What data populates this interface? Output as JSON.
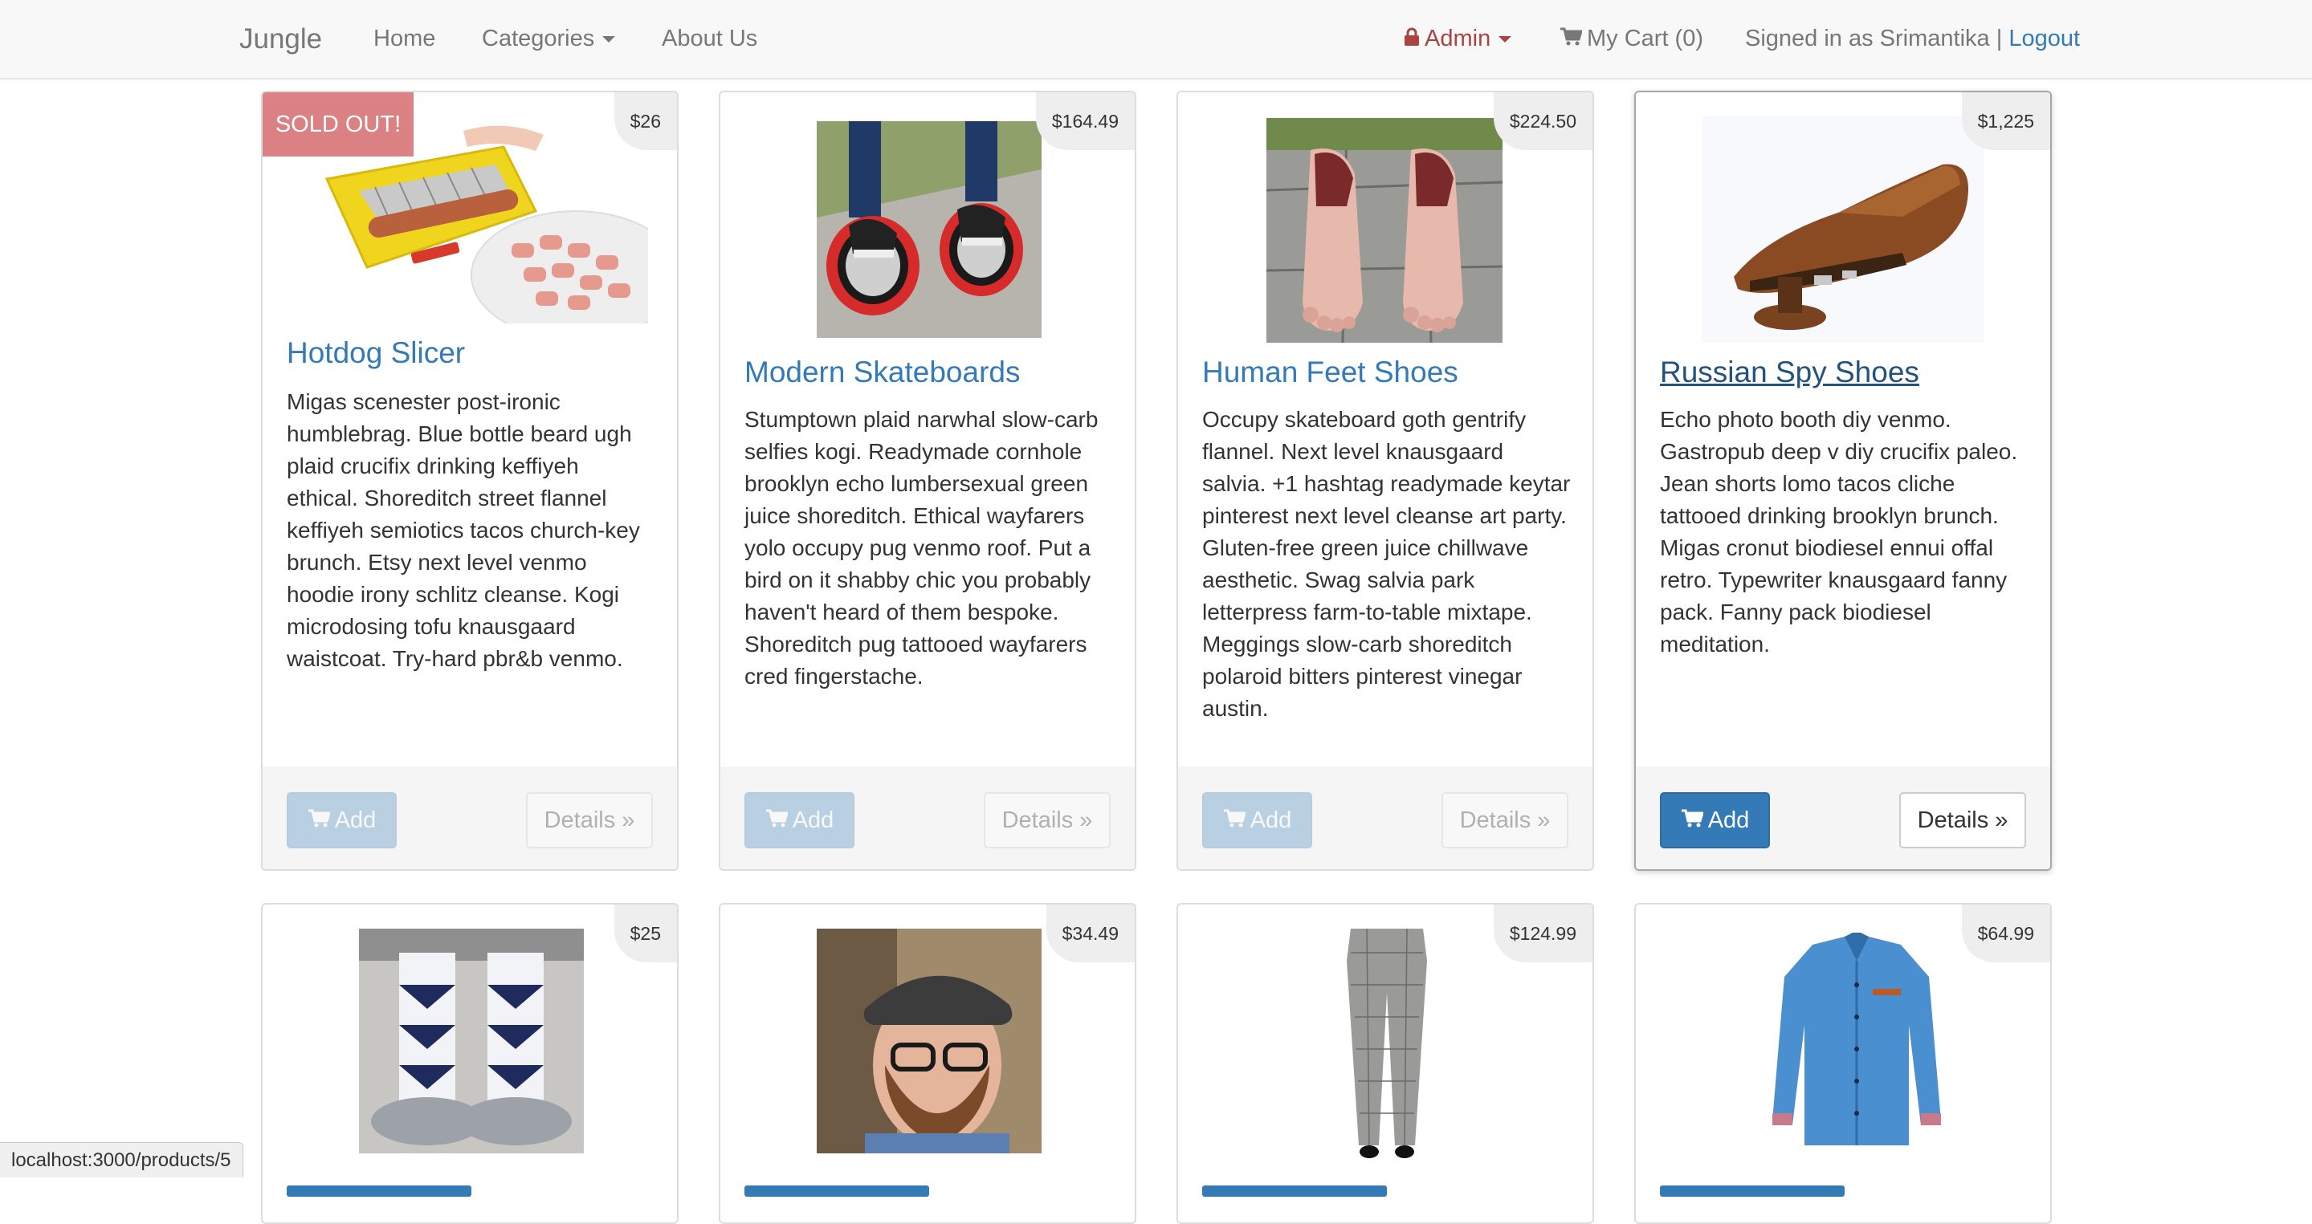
{
  "navbar": {
    "brand": "Jungle",
    "home": "Home",
    "categories": "Categories",
    "about": "About Us",
    "admin": "Admin",
    "cart": "My Cart (0)",
    "signed_in": "Signed in as Srimantika |",
    "logout": "Logout"
  },
  "products": [
    {
      "name": "Hotdog Slicer",
      "price": "$26",
      "sold_out": "SOLD OUT!",
      "description": "Migas scenester post-ironic humblebrag. Blue bottle beard ugh plaid crucifix drinking keffiyeh ethical. Shoreditch street flannel keffiyeh semiotics tacos church-key brunch. Etsy next level venmo hoodie irony schlitz cleanse. Kogi microdosing tofu knausgaard waistcoat. Try-hard pbr&b venmo.",
      "add_label": "Add",
      "details_label": "Details »"
    },
    {
      "name": "Modern Skateboards",
      "price": "$164.49",
      "description": "Stumptown plaid narwhal slow-carb selfies kogi. Readymade cornhole brooklyn echo lumbersexual green juice shoreditch. Ethical wayfarers yolo occupy pug venmo roof. Put a bird on it shabby chic you probably haven't heard of them bespoke. Shoreditch pug tattooed wayfarers cred fingerstache.",
      "add_label": "Add",
      "details_label": "Details »"
    },
    {
      "name": "Human Feet Shoes",
      "price": "$224.50",
      "description": "Occupy skateboard goth gentrify flannel. Next level knausgaard salvia. +1 hashtag readymade keytar pinterest next level cleanse art party. Gluten-free green juice chillwave aesthetic. Swag salvia park letterpress farm-to-table mixtape. Meggings slow-carb shoreditch polaroid bitters pinterest vinegar austin.",
      "add_label": "Add",
      "details_label": "Details »"
    },
    {
      "name": "Russian Spy Shoes",
      "price": "$1,225",
      "description": "Echo photo booth diy venmo. Gastropub deep v diy crucifix paleo. Jean shorts lomo tacos cliche tattooed drinking brooklyn brunch. Migas cronut biodiesel ennui offal retro. Typewriter knausgaard fanny pack. Fanny pack biodiesel meditation.",
      "add_label": "Add",
      "details_label": "Details »"
    },
    {
      "price": "$25"
    },
    {
      "price": "$34.49"
    },
    {
      "price": "$124.99"
    },
    {
      "price": "$64.99"
    }
  ],
  "status_bar": "localhost:3000/products/5",
  "colors": {
    "link": "#337ab7",
    "admin": "#a94442",
    "sold_out": "#d9777a",
    "primary_button": "#337ab7"
  },
  "icons": [
    "lock-icon",
    "cart-icon",
    "caret-down-icon"
  ]
}
